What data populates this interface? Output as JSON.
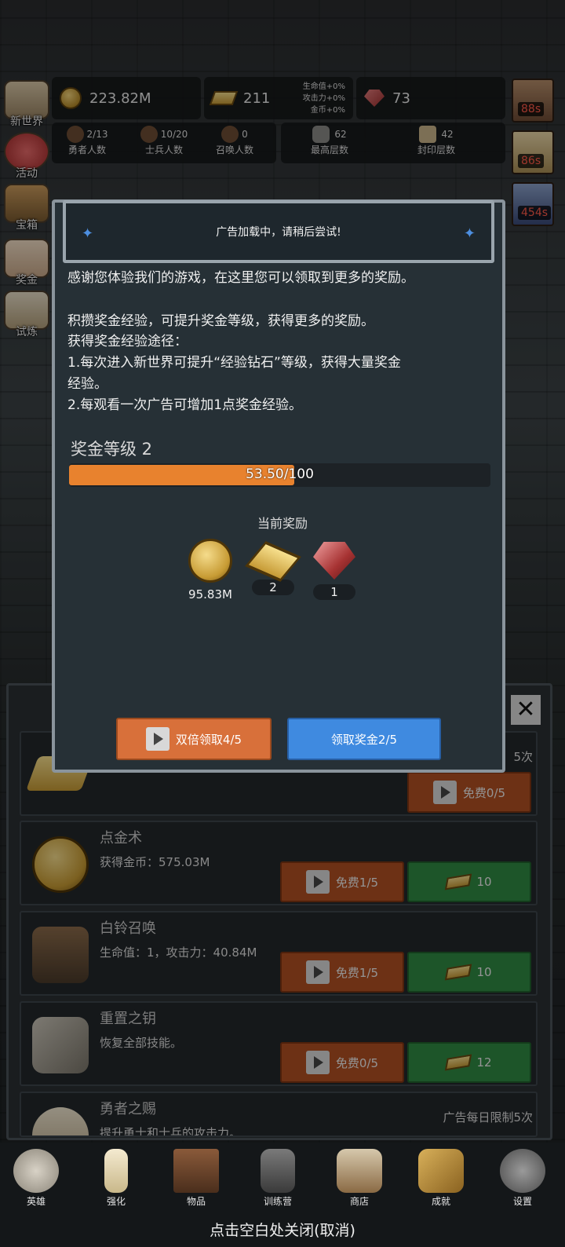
{
  "top_stats": {
    "gold": "223.82M",
    "gold_bars": "211",
    "bonus_lines": [
      "生命值+0%",
      "攻击力+0%",
      "金币+0%"
    ],
    "gems": "73"
  },
  "sub_stats": [
    {
      "value": "2/13",
      "label": "勇者人数"
    },
    {
      "value": "10/20",
      "label": "士兵人数"
    },
    {
      "value": "0",
      "label": "召唤人数"
    },
    {
      "value": "62",
      "label": "最高层数"
    },
    {
      "value": "42",
      "label": "封印层数"
    }
  ],
  "side_menu": [
    "新世界",
    "活动",
    "宝箱",
    "奖金",
    "试炼"
  ],
  "timers": [
    "88s",
    "86s",
    "454s"
  ],
  "toast": {
    "text": "广告加载中，请稍后尝试!"
  },
  "dialog": {
    "intro": "感谢您体验我们的游戏，在这里您可以领取到更多的奖励。",
    "lines": [
      "积攒奖金经验，可提升奖金等级，获得更多的奖励。",
      "获得奖金经验途径：",
      "1.每次进入新世界可提升“经验钻石”等级，获得大量奖金",
      "经验。",
      "2.每观看一次广告可增加1点奖金经验。"
    ],
    "level_title": "奖金等级 2",
    "progress_text": "53.50/100",
    "progress_fraction": 0.535,
    "reward_heading": "当前奖励",
    "rewards": [
      {
        "icon": "gold-coin-icon",
        "value": "95.83M"
      },
      {
        "icon": "gold-bar-icon",
        "value": "2"
      },
      {
        "icon": "red-gem-icon",
        "value": "1"
      }
    ],
    "double_button": "双倍领取4/5",
    "claim_button": "领取奖金2/5"
  },
  "shop": {
    "row0": {
      "limit": "5次",
      "free_btn": "免费0/5"
    },
    "row1": {
      "title": "点金术",
      "desc": "获得金币：575.03M",
      "free_btn": "免费1/5",
      "cost": "10"
    },
    "row2": {
      "title": "白铃召唤",
      "desc": "生命值：1，攻击力：40.84M",
      "free_btn": "免费1/5",
      "cost": "10"
    },
    "row3": {
      "title": "重置之钥",
      "desc": "恢复全部技能。",
      "free_btn": "免费0/5",
      "cost": "12"
    },
    "row4": {
      "title": "勇者之赐",
      "desc": "提升勇士和士兵的攻击力。",
      "limit": "广告每日限制5次"
    }
  },
  "bottom_nav": [
    "英雄",
    "强化",
    "物品",
    "训练营",
    "商店",
    "成就",
    "设置"
  ],
  "close_hint": "点击空白处关闭(取消)",
  "colors": {
    "accent_orange": "#e8822e",
    "button_orange": "#d8703a",
    "button_blue": "#3f8ae0",
    "button_green": "#2f8a43"
  }
}
